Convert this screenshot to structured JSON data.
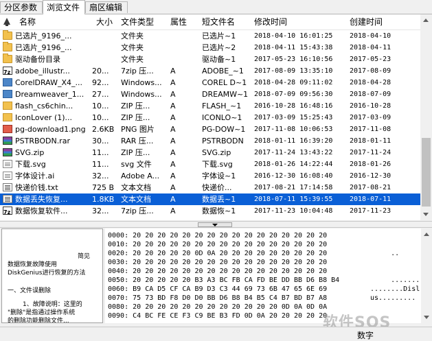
{
  "tabs": [
    {
      "label": "分区参数",
      "active": false
    },
    {
      "label": "浏览文件",
      "active": true
    },
    {
      "label": "扇区编辑",
      "active": false
    }
  ],
  "columns": {
    "name": "名称",
    "size": "大小",
    "type": "文件类型",
    "attr": "属性",
    "short": "短文件名",
    "modified": "修改时间",
    "created": "创建时间"
  },
  "files": [
    {
      "icon": "folder-icon",
      "name": "已选片_9196_...",
      "size": "",
      "type": "文件夹",
      "attr": "",
      "short": "已选片~1",
      "modified": "2018-04-10 16:01:25",
      "created": "2018-04-10"
    },
    {
      "icon": "folder-icon",
      "name": "已选片_9196_...",
      "size": "",
      "type": "文件夹",
      "attr": "",
      "short": "已选片~2",
      "modified": "2018-04-11 15:43:38",
      "created": "2018-04-11"
    },
    {
      "icon": "folder-icon",
      "name": "驱动备份目录",
      "size": "",
      "type": "文件夹",
      "attr": "",
      "short": "驱动备~1",
      "modified": "2017-05-23 16:10:56",
      "created": "2017-05-23"
    },
    {
      "icon": "archive-icon",
      "name": "adobe_illustr...",
      "size": "20...",
      "type": "7zip 压...",
      "attr": "A",
      "short": "ADOBE_~1",
      "modified": "2017-08-09 13:35:10",
      "created": "2017-08-09"
    },
    {
      "icon": "app-icon",
      "name": "CorelDRAW_X4_...",
      "size": "92...",
      "type": "Windows...",
      "attr": "A",
      "short": "COREL D~1",
      "modified": "2018-04-28 09:11:02",
      "created": "2018-04-28"
    },
    {
      "icon": "app-icon",
      "name": "Dreamweaver_1...",
      "size": "27...",
      "type": "Windows...",
      "attr": "A",
      "short": "DREAMW~1",
      "modified": "2018-07-09 09:56:30",
      "created": "2018-07-09"
    },
    {
      "icon": "flash-icon",
      "name": "flash_cs6chin...",
      "size": "10...",
      "type": "ZIP 压...",
      "attr": "A",
      "short": "FLASH_~1",
      "modified": "2016-10-28 16:48:16",
      "created": "2016-10-28"
    },
    {
      "icon": "flash-icon",
      "name": "IconLover (1)...",
      "size": "10...",
      "type": "ZIP 压...",
      "attr": "A",
      "short": "ICONLO~1",
      "modified": "2017-03-09 15:25:43",
      "created": "2017-03-09"
    },
    {
      "icon": "png-icon",
      "name": "pg-download1.png",
      "size": "2.6KB",
      "type": "PNG 图片",
      "attr": "A",
      "short": "PG-DOW~1",
      "modified": "2017-11-08 10:06:53",
      "created": "2017-11-08"
    },
    {
      "icon": "rar-icon",
      "name": "PSTRBODN.rar",
      "size": "30...",
      "type": "RAR 压...",
      "attr": "A",
      "short": "PSTRBODN",
      "modified": "2018-01-11 16:39:20",
      "created": "2018-01-11"
    },
    {
      "icon": "rar-icon",
      "name": "SVG.zip",
      "size": "11...",
      "type": "ZIP 压...",
      "attr": "A",
      "short": "SVG.zip",
      "modified": "2017-11-24 13:43:22",
      "created": "2017-11-24"
    },
    {
      "icon": "doc-icon",
      "name": "下载.svg",
      "size": "11...",
      "type": "svg 文件",
      "attr": "A",
      "short": "下载.svg",
      "modified": "2018-01-26 14:22:44",
      "created": "2018-01-26"
    },
    {
      "icon": "doc-icon",
      "name": "字体设计.ai",
      "size": "32...",
      "type": "Adobe A...",
      "attr": "A",
      "short": "字体设~1",
      "modified": "2016-12-30 16:08:40",
      "created": "2016-12-30"
    },
    {
      "icon": "txt-icon",
      "name": "快递价钱.txt",
      "size": "725 B",
      "type": "文本文档",
      "attr": "A",
      "short": "快递价...",
      "modified": "2017-08-21 17:14:58",
      "created": "2017-08-21"
    },
    {
      "icon": "txt-icon",
      "name": "数据丢失恢复...",
      "size": "1.8KB",
      "type": "文本文档",
      "attr": "A",
      "short": "数据丢~1",
      "modified": "2018-07-11 15:39:55",
      "created": "2018-07-11",
      "selected": true
    },
    {
      "icon": "archive-icon",
      "name": "数据恢复软件...",
      "size": "32...",
      "type": "7zip 压...",
      "attr": "A",
      "short": "数据恢~1",
      "modified": "2017-11-23 10:04:48",
      "created": "2017-11-23"
    }
  ],
  "preview_lines": [
    "简见",
    "数据恢复故障使用",
    "DiskGenius进行恢复的方法",
    "一、文件误删除",
    "1、故障说明：这里的",
    "\"删除\"是指通过操作系统",
    "的删除功能删除文件..."
  ],
  "hex_rows": [
    {
      "offset": "0000:",
      "bytes": "20 20 20 20 20 20 20 20 20 20 20 20 20 20 20 20",
      "ascii": ""
    },
    {
      "offset": "0010:",
      "bytes": "20 20 20 20 20 20 20 20 20 20 20 20 20 20 20 20",
      "ascii": ""
    },
    {
      "offset": "0020:",
      "bytes": "20 20 20 20 20 0D 0A 20 20 20 20 20 20 20 20 20",
      "ascii": "     .."
    },
    {
      "offset": "0030:",
      "bytes": "20 20 20 20 20 20 20 20 20 20 20 20 20 20 20 20",
      "ascii": ""
    },
    {
      "offset": "0040:",
      "bytes": "20 20 20 20 20 20 20 20 20 20 20 20 20 20 20 20",
      "ascii": ""
    },
    {
      "offset": "0050:",
      "bytes": "20 20 20 20 20 B3 A3 BC FB CA FD BE DD BB D6 B8 B4",
      "ascii": "     ........"
    },
    {
      "offset": "0060:",
      "bytes": "B9 CA D5 CF CA B9 D3 C3 44 69 73 6B 47 65 6E 69",
      "ascii": "........Disl"
    },
    {
      "offset": "0070:",
      "bytes": "75 73 BD F8 D0 D0 BB D6 B8 B4 B5 C4 B7 BD B7 A8",
      "ascii": "us........."
    },
    {
      "offset": "0080:",
      "bytes": "20 20 20 20 20 20 20 20 20 20 20 20 0D 0A 0D 0A",
      "ascii": ""
    },
    {
      "offset": "0090:",
      "bytes": "C4 BC FE CE F3 C9 BE B3 FD 0D 0A 20 20 20 20 20",
      "ascii": ""
    }
  ],
  "status": {
    "mode": "数字"
  },
  "watermark": "软件SOS"
}
